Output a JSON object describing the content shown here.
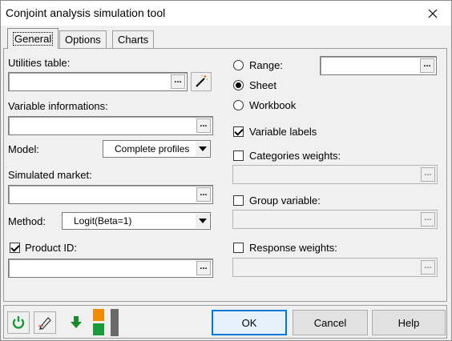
{
  "window": {
    "title": "Conjoint analysis simulation tool"
  },
  "tabs": [
    "General",
    "Options",
    "Charts"
  ],
  "left": {
    "utilities_table_label": "Utilities table:",
    "variable_info_label": "Variable informations:",
    "model_label": "Model:",
    "model_value": "Complete profiles",
    "simulated_market_label": "Simulated market:",
    "method_label": "Method:",
    "method_value": "Logit(Beta=1)",
    "product_id_label": "Product ID:",
    "product_id_checked": true
  },
  "right": {
    "range_label": "Range:",
    "sheet_label": "Sheet",
    "workbook_label": "Workbook",
    "output_selected": "Sheet",
    "variable_labels_label": "Variable labels",
    "variable_labels_checked": true,
    "categories_weights_label": "Categories weights:",
    "group_variable_label": "Group variable:",
    "response_weights_label": "Response weights:"
  },
  "buttons": {
    "ok": "OK",
    "cancel": "Cancel",
    "help": "Help"
  },
  "dropdown_glyph": "...",
  "icons": [
    "close-icon",
    "magic-wand-icon",
    "reset-icon",
    "pencil-icon",
    "down-arrow-icon",
    "color-blocks-icon",
    "chevron-down-icon"
  ],
  "colors": {
    "accent": "#0078d7",
    "green": "#1a9a3a",
    "orange": "#f08a00"
  }
}
